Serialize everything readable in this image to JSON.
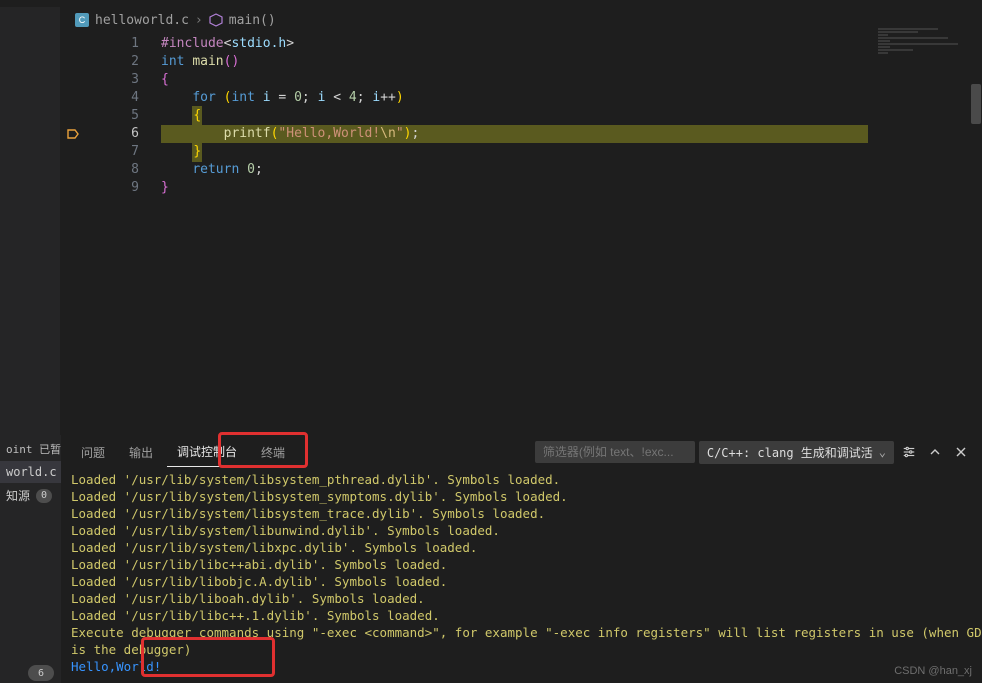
{
  "breadcrumb": {
    "file_label": "helloworld.c",
    "symbol_label": "main()",
    "file_badge": "C"
  },
  "code": {
    "lines": [
      {
        "n": "1",
        "tokens": [
          [
            "inc",
            "#include"
          ],
          [
            "pu",
            "<"
          ],
          [
            "id",
            "stdio.h"
          ],
          [
            "pu",
            ">"
          ]
        ]
      },
      {
        "n": "2",
        "tokens": [
          [
            "ty",
            "int "
          ],
          [
            "fn",
            "main"
          ],
          [
            "br",
            "()"
          ]
        ]
      },
      {
        "n": "3",
        "tokens": [
          [
            "br",
            "{"
          ]
        ]
      },
      {
        "n": "4",
        "tokens": [
          [
            "pu",
            "    "
          ],
          [
            "kw",
            "for "
          ],
          [
            "br2",
            "("
          ],
          [
            "ty",
            "int "
          ],
          [
            "id",
            "i"
          ],
          [
            "pu",
            " = "
          ],
          [
            "num",
            "0"
          ],
          [
            "pu",
            "; "
          ],
          [
            "id",
            "i"
          ],
          [
            "pu",
            " < "
          ],
          [
            "num",
            "4"
          ],
          [
            "pu",
            "; "
          ],
          [
            "id",
            "i"
          ],
          [
            "pu",
            "++"
          ],
          [
            "br2",
            ")"
          ]
        ]
      },
      {
        "n": "5",
        "tokens": [
          [
            "pu",
            "    "
          ],
          [
            "brh",
            "{"
          ]
        ]
      },
      {
        "n": "6",
        "tokens": [
          [
            "pu",
            "        "
          ],
          [
            "fn",
            "printf"
          ],
          [
            "br2",
            "("
          ],
          [
            "str",
            "\"Hello,World!"
          ],
          [
            "esc",
            "\\n"
          ],
          [
            "str",
            "\""
          ],
          [
            "br2",
            ")"
          ],
          [
            "pu",
            ";"
          ]
        ],
        "highlight": true,
        "bp": true
      },
      {
        "n": "7",
        "tokens": [
          [
            "pu",
            "    "
          ],
          [
            "brh",
            "}"
          ]
        ]
      },
      {
        "n": "8",
        "tokens": [
          [
            "pu",
            "    "
          ],
          [
            "kw",
            "return "
          ],
          [
            "num",
            "0"
          ],
          [
            "pu",
            ";"
          ]
        ]
      },
      {
        "n": "9",
        "tokens": [
          [
            "br",
            "}"
          ]
        ]
      }
    ]
  },
  "side": {
    "header": "oint 已暂停",
    "open_file": "world.c",
    "sources_label": "知源",
    "sources_count": "0"
  },
  "tabs": {
    "problems": "问题",
    "output": "输出",
    "debug_console": "调试控制台",
    "terminal": "终端"
  },
  "toolbar": {
    "filter_placeholder": "筛选器(例如 text、!exc...",
    "config_label": "C/C++: clang 生成和调试活"
  },
  "console_lines": [
    {
      "cls": "loaded",
      "text": "Loaded '/usr/lib/system/libsystem_pthread.dylib'. Symbols loaded."
    },
    {
      "cls": "loaded",
      "text": "Loaded '/usr/lib/system/libsystem_symptoms.dylib'. Symbols loaded."
    },
    {
      "cls": "loaded",
      "text": "Loaded '/usr/lib/system/libsystem_trace.dylib'. Symbols loaded."
    },
    {
      "cls": "loaded",
      "text": "Loaded '/usr/lib/system/libunwind.dylib'. Symbols loaded."
    },
    {
      "cls": "loaded",
      "text": "Loaded '/usr/lib/system/libxpc.dylib'. Symbols loaded."
    },
    {
      "cls": "loaded",
      "text": "Loaded '/usr/lib/libc++abi.dylib'. Symbols loaded."
    },
    {
      "cls": "loaded",
      "text": "Loaded '/usr/lib/libobjc.A.dylib'. Symbols loaded."
    },
    {
      "cls": "loaded",
      "text": "Loaded '/usr/lib/liboah.dylib'. Symbols loaded."
    },
    {
      "cls": "loaded",
      "text": "Loaded '/usr/lib/libc++.1.dylib'. Symbols loaded."
    },
    {
      "cls": "loaded",
      "text": "Execute debugger commands using \"-exec <command>\", for example \"-exec info registers\" will list registers in use (when GDB"
    },
    {
      "cls": "loaded",
      "text": "is the debugger)"
    },
    {
      "cls": "out",
      "text": "Hello,World!"
    }
  ],
  "page_indicator": "6",
  "watermark": "CSDN @han_xj"
}
